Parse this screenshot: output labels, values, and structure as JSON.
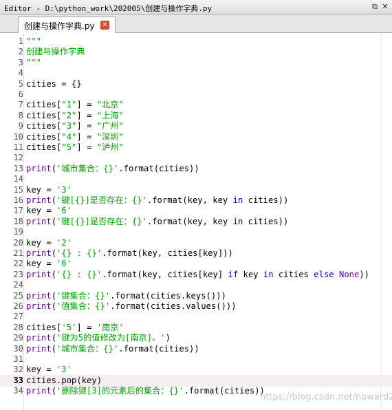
{
  "window": {
    "title": "Editor - D:\\python_work\\202005\\创建与操作字典.py",
    "undock_icon": "undock-icon",
    "close_icon": "close-icon"
  },
  "tabbar": {
    "browse_icon": "folder-tab-icon",
    "tab_label": "创建与操作字典.py",
    "options_icon": "gear-icon"
  },
  "editor": {
    "current_line": 33,
    "lines": [
      {
        "n": "1",
        "segs": [
          {
            "t": "\"\"\"",
            "c": "str"
          }
        ]
      },
      {
        "n": "2",
        "segs": [
          {
            "t": "创建与操作字典",
            "c": "str"
          }
        ]
      },
      {
        "n": "3",
        "segs": [
          {
            "t": "\"\"\"",
            "c": "str"
          }
        ]
      },
      {
        "n": "4",
        "segs": []
      },
      {
        "n": "5",
        "segs": [
          {
            "t": "cities = {}",
            "c": ""
          }
        ]
      },
      {
        "n": "6",
        "segs": []
      },
      {
        "n": "7",
        "segs": [
          {
            "t": "cities[",
            "c": ""
          },
          {
            "t": "\"1\"",
            "c": "str"
          },
          {
            "t": "] = ",
            "c": ""
          },
          {
            "t": "\"北京\"",
            "c": "str"
          }
        ]
      },
      {
        "n": "8",
        "segs": [
          {
            "t": "cities[",
            "c": ""
          },
          {
            "t": "\"2\"",
            "c": "str"
          },
          {
            "t": "] = ",
            "c": ""
          },
          {
            "t": "\"上海\"",
            "c": "str"
          }
        ]
      },
      {
        "n": "9",
        "segs": [
          {
            "t": "cities[",
            "c": ""
          },
          {
            "t": "\"3\"",
            "c": "str"
          },
          {
            "t": "] = ",
            "c": ""
          },
          {
            "t": "\"广州\"",
            "c": "str"
          }
        ]
      },
      {
        "n": "10",
        "segs": [
          {
            "t": "cities[",
            "c": ""
          },
          {
            "t": "\"4\"",
            "c": "str"
          },
          {
            "t": "] = ",
            "c": ""
          },
          {
            "t": "\"深圳\"",
            "c": "str"
          }
        ]
      },
      {
        "n": "11",
        "segs": [
          {
            "t": "cities[",
            "c": ""
          },
          {
            "t": "\"5\"",
            "c": "str"
          },
          {
            "t": "] = ",
            "c": ""
          },
          {
            "t": "\"泸州\"",
            "c": "str"
          }
        ]
      },
      {
        "n": "12",
        "segs": []
      },
      {
        "n": "13",
        "segs": [
          {
            "t": "print",
            "c": "fn"
          },
          {
            "t": "(",
            "c": ""
          },
          {
            "t": "'城市集合：{}'",
            "c": "str"
          },
          {
            "t": ".format(cities))",
            "c": ""
          }
        ]
      },
      {
        "n": "14",
        "segs": []
      },
      {
        "n": "15",
        "segs": [
          {
            "t": "key = ",
            "c": ""
          },
          {
            "t": "'3'",
            "c": "str"
          }
        ]
      },
      {
        "n": "16",
        "segs": [
          {
            "t": "print",
            "c": "fn"
          },
          {
            "t": "(",
            "c": ""
          },
          {
            "t": "'键[{}]是否存在：{}'",
            "c": "str"
          },
          {
            "t": ".format(key, key ",
            "c": ""
          },
          {
            "t": "in",
            "c": "kw"
          },
          {
            "t": " cities))",
            "c": ""
          }
        ]
      },
      {
        "n": "17",
        "segs": [
          {
            "t": "key = ",
            "c": ""
          },
          {
            "t": "'6'",
            "c": "str"
          }
        ]
      },
      {
        "n": "18",
        "segs": [
          {
            "t": "print",
            "c": "fn"
          },
          {
            "t": "(",
            "c": ""
          },
          {
            "t": "'键[{}]是否存在：{}'",
            "c": "str"
          },
          {
            "t": ".format(key, key ",
            "c": ""
          },
          {
            "t": "in",
            "c": "kw"
          },
          {
            "t": " cities))",
            "c": ""
          }
        ]
      },
      {
        "n": "19",
        "segs": []
      },
      {
        "n": "20",
        "segs": [
          {
            "t": "key = ",
            "c": ""
          },
          {
            "t": "'2'",
            "c": "str"
          }
        ]
      },
      {
        "n": "21",
        "segs": [
          {
            "t": "print",
            "c": "fn"
          },
          {
            "t": "(",
            "c": ""
          },
          {
            "t": "'{} : {}'",
            "c": "str"
          },
          {
            "t": ".format(key, cities[key]))",
            "c": ""
          }
        ]
      },
      {
        "n": "22",
        "segs": [
          {
            "t": "key = ",
            "c": ""
          },
          {
            "t": "'6'",
            "c": "str"
          }
        ]
      },
      {
        "n": "23",
        "segs": [
          {
            "t": "print",
            "c": "fn"
          },
          {
            "t": "(",
            "c": ""
          },
          {
            "t": "'{} : {}'",
            "c": "str"
          },
          {
            "t": ".format(key, cities[key] ",
            "c": ""
          },
          {
            "t": "if",
            "c": "kw"
          },
          {
            "t": " key ",
            "c": ""
          },
          {
            "t": "in",
            "c": "kw"
          },
          {
            "t": " cities ",
            "c": ""
          },
          {
            "t": "else",
            "c": "kw"
          },
          {
            "t": " ",
            "c": ""
          },
          {
            "t": "None",
            "c": "fn"
          },
          {
            "t": "))",
            "c": ""
          }
        ]
      },
      {
        "n": "24",
        "segs": []
      },
      {
        "n": "25",
        "segs": [
          {
            "t": "print",
            "c": "fn"
          },
          {
            "t": "(",
            "c": ""
          },
          {
            "t": "'键集合：{}'",
            "c": "str"
          },
          {
            "t": ".format(cities.keys()))",
            "c": ""
          }
        ]
      },
      {
        "n": "26",
        "segs": [
          {
            "t": "print",
            "c": "fn"
          },
          {
            "t": "(",
            "c": ""
          },
          {
            "t": "'值集合：{}'",
            "c": "str"
          },
          {
            "t": ".format(cities.values()))",
            "c": ""
          }
        ]
      },
      {
        "n": "27",
        "segs": []
      },
      {
        "n": "28",
        "segs": [
          {
            "t": "cities[",
            "c": ""
          },
          {
            "t": "'5'",
            "c": "str"
          },
          {
            "t": "] = ",
            "c": ""
          },
          {
            "t": "'南京'",
            "c": "str"
          }
        ]
      },
      {
        "n": "29",
        "segs": [
          {
            "t": "print",
            "c": "fn"
          },
          {
            "t": "(",
            "c": ""
          },
          {
            "t": "'键为5的值修改为[南京]。'",
            "c": "str"
          },
          {
            "t": ")",
            "c": ""
          }
        ]
      },
      {
        "n": "30",
        "segs": [
          {
            "t": "print",
            "c": "fn"
          },
          {
            "t": "(",
            "c": ""
          },
          {
            "t": "'城市集合：{}'",
            "c": "str"
          },
          {
            "t": ".format(cities))",
            "c": ""
          }
        ]
      },
      {
        "n": "31",
        "segs": []
      },
      {
        "n": "32",
        "segs": [
          {
            "t": "key = ",
            "c": ""
          },
          {
            "t": "'3'",
            "c": "str"
          }
        ]
      },
      {
        "n": "33",
        "segs": [
          {
            "t": "cities.pop(key)",
            "c": ""
          }
        ]
      },
      {
        "n": "34",
        "segs": [
          {
            "t": "print",
            "c": "fn"
          },
          {
            "t": "(",
            "c": ""
          },
          {
            "t": "'删除键[3]的元素后的集合：{}'",
            "c": "str"
          },
          {
            "t": ".format(cities))",
            "c": ""
          }
        ]
      }
    ]
  },
  "watermark": "https://blog.csdn.net/howard2005"
}
